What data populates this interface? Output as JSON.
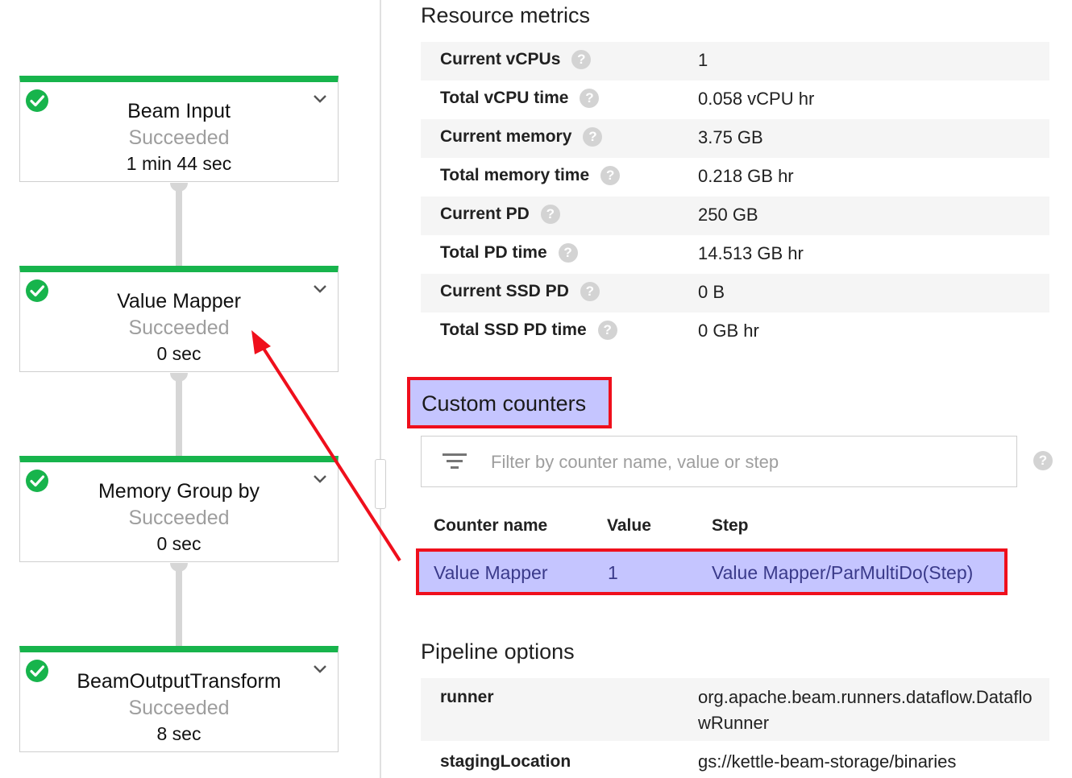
{
  "pipeline": {
    "steps": [
      {
        "title": "Beam Input",
        "status": "Succeeded",
        "duration": "1 min 44 sec"
      },
      {
        "title": "Value Mapper",
        "status": "Succeeded",
        "duration": "0 sec"
      },
      {
        "title": "Memory Group by",
        "status": "Succeeded",
        "duration": "0 sec"
      },
      {
        "title": "BeamOutputTransform",
        "status": "Succeeded",
        "duration": "8 sec"
      }
    ]
  },
  "resource_metrics": {
    "title": "Resource metrics",
    "rows": [
      {
        "label": "Current vCPUs",
        "value": "1"
      },
      {
        "label": "Total vCPU time",
        "value": "0.058 vCPU hr"
      },
      {
        "label": "Current memory",
        "value": "3.75 GB"
      },
      {
        "label": "Total memory time",
        "value": "0.218 GB hr"
      },
      {
        "label": "Current PD",
        "value": "250 GB"
      },
      {
        "label": "Total PD time",
        "value": "14.513 GB hr"
      },
      {
        "label": "Current SSD PD",
        "value": "0 B"
      },
      {
        "label": "Total SSD PD time",
        "value": "0 GB hr"
      }
    ]
  },
  "custom_counters": {
    "title": "Custom counters",
    "filter_placeholder": "Filter by counter name, value or step",
    "columns": {
      "name": "Counter name",
      "value": "Value",
      "step": "Step"
    },
    "rows": [
      {
        "name": "Value Mapper",
        "value": "1",
        "step": "Value Mapper/ParMultiDo(Step)"
      }
    ]
  },
  "pipeline_options": {
    "title": "Pipeline options",
    "rows": [
      {
        "label": "runner",
        "value": "org.apache.beam.runners.dataflow.DataflowRunner"
      },
      {
        "label": "stagingLocation",
        "value": "gs://kettle-beam-storage/binaries"
      }
    ]
  },
  "help_glyph": "?",
  "colors": {
    "success_green": "#17b44c",
    "highlight_red": "#ef0f1c",
    "highlight_fill": "#c5c5ff"
  }
}
